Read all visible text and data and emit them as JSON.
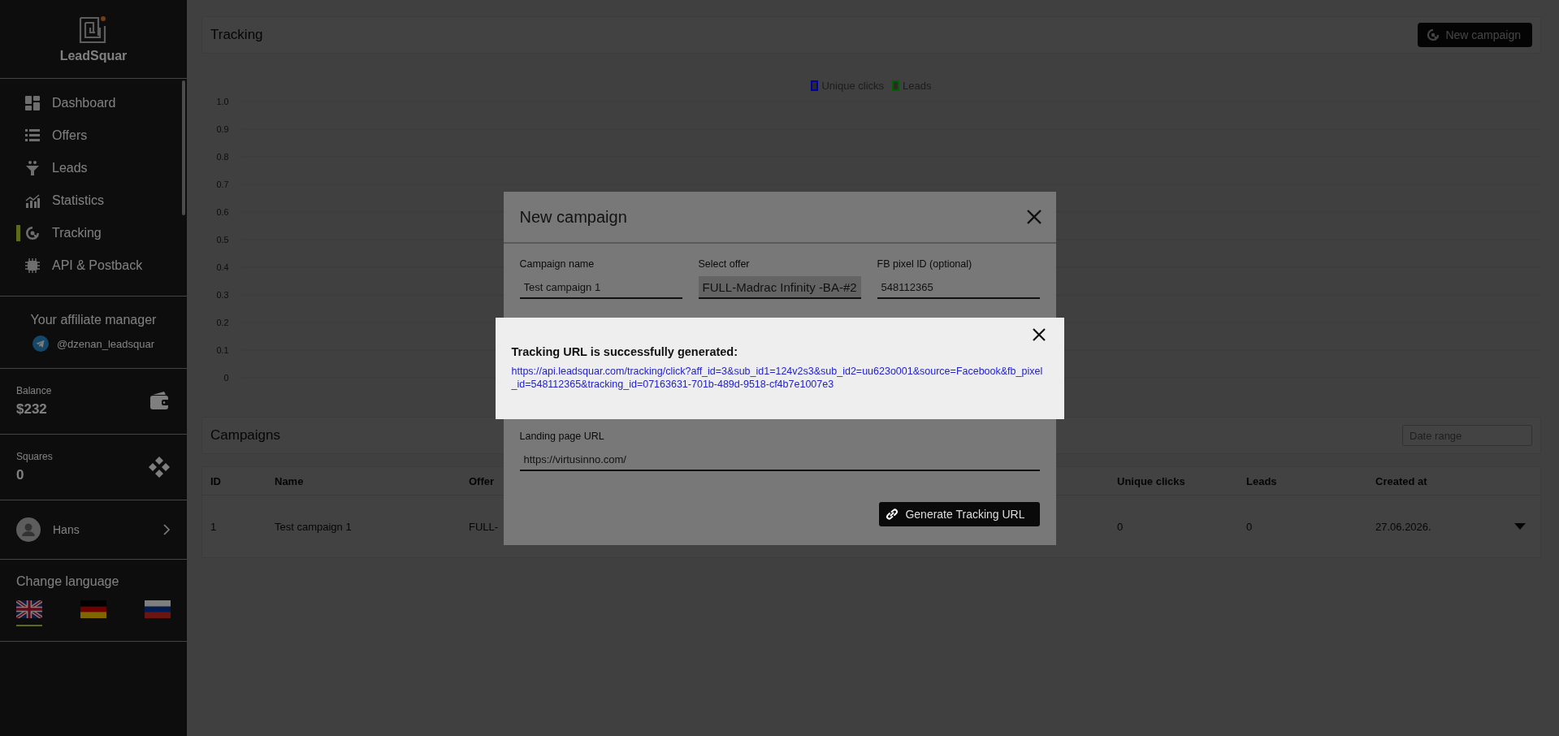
{
  "sidebar": {
    "logo_text": "LeadSquar",
    "nav": [
      {
        "label": "Dashboard",
        "selected": false
      },
      {
        "label": "Offers",
        "selected": false
      },
      {
        "label": "Leads",
        "selected": false
      },
      {
        "label": "Statistics",
        "selected": false
      },
      {
        "label": "Tracking",
        "selected": true
      },
      {
        "label": "API & Postback",
        "selected": false
      }
    ],
    "manager": {
      "title": "Your affiliate manager",
      "handle": "@dzenan_leadsquar"
    },
    "balance": {
      "label": "Balance",
      "value": "$232"
    },
    "squares": {
      "label": "Squares",
      "value": "0"
    },
    "user": {
      "name": "Hans"
    },
    "language": {
      "title": "Change language",
      "flags": [
        {
          "kind": "uk",
          "selected": true
        },
        {
          "kind": "de",
          "selected": false
        },
        {
          "kind": "ru",
          "selected": false
        }
      ]
    }
  },
  "header": {
    "title": "Tracking",
    "button": "New campaign"
  },
  "chart": {
    "legend": [
      {
        "name": "Unique clicks",
        "color": "#0000a0"
      },
      {
        "name": "Leads",
        "color": "#006000"
      }
    ],
    "axis_labels": [
      "1.0",
      "0.9",
      "0.8",
      "0.7",
      "0.6",
      "0.5",
      "0.4",
      "0.3",
      "0.2",
      "0.1",
      "0"
    ]
  },
  "campaigns": {
    "title": "Campaigns",
    "date_placeholder": "Date range",
    "columns": [
      {
        "label": "ID"
      },
      {
        "label": "Name"
      },
      {
        "label": "Offer"
      },
      {
        "label": "Unique clicks"
      },
      {
        "label": "Leads"
      },
      {
        "label": "Created at"
      }
    ],
    "rows": [
      {
        "cells": [
          "1",
          "Test campaign 1",
          "FULL-",
          "0",
          "0",
          "27.06.2026."
        ]
      }
    ]
  },
  "modal": {
    "title": "New campaign",
    "fields": [
      {
        "label": "Campaign name",
        "value": "Test campaign 1",
        "kind": "text"
      },
      {
        "label": "Select offer",
        "value": "FULL-Madrac Infinity -BA-#2",
        "kind": "select"
      },
      {
        "label": "FB pixel ID (optional)",
        "value": "548112365",
        "kind": "text"
      }
    ],
    "landing": {
      "label": "Landing page URL",
      "value": "https://virtusinno.com/"
    },
    "button": "Generate Tracking URL"
  },
  "alert": {
    "title": "Tracking URL is successfully generated:",
    "url": "https://api.leadsquar.com/tracking/click?aff_id=3&sub_id1=124v2s3&sub_id2=uu623o001&source=Facebook&fb_pixel_id=548112365&tracking_id=07163631-701b-489d-9518-cf4b7e1007e3"
  }
}
